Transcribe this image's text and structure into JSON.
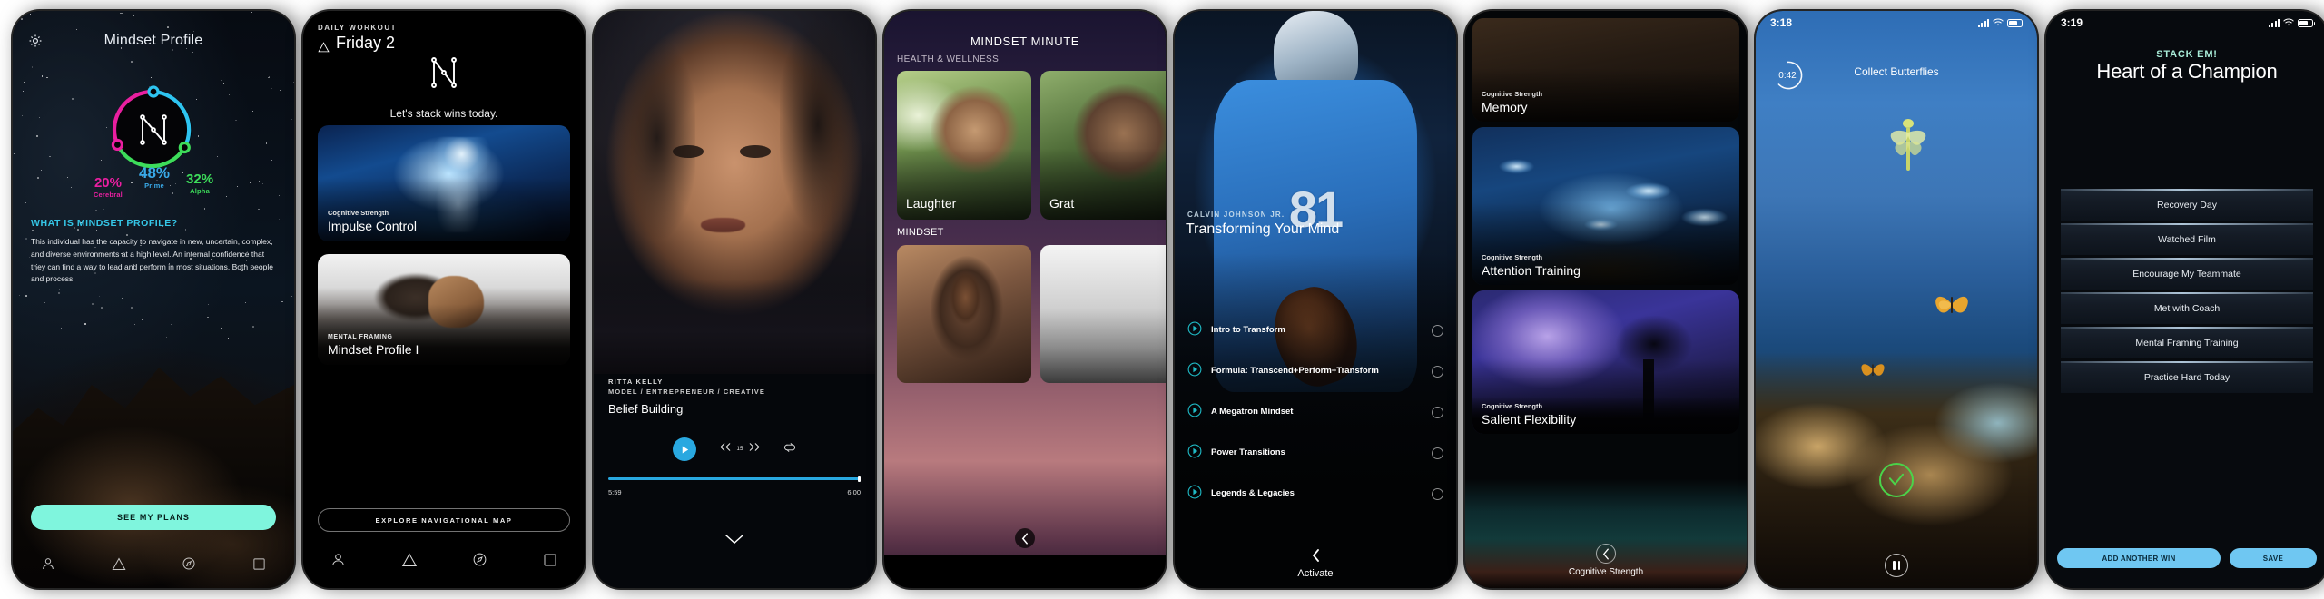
{
  "screens": {
    "profile": {
      "title": "Mindset Profile",
      "gear_icon": "gear-icon",
      "logo": "neuro-n-logo",
      "metrics": [
        {
          "value": "20%",
          "label": "Cerebral",
          "color": "#e91fa0"
        },
        {
          "value": "48%",
          "label": "Prime",
          "color": "#39a9e8"
        },
        {
          "value": "32%",
          "label": "Alpha",
          "color": "#3ddc5a"
        }
      ],
      "section_heading": "WHAT IS MINDSET PROFILE?",
      "body": "This individual has the capacity to navigate in new, uncertain, complex, and diverse environments at a high level. An internal confidence that they can find a way to lead and perform in most situations. Both people and process",
      "cta": "SEE MY PLANS",
      "tabs": [
        "profile-icon",
        "triangle-icon",
        "compass-icon",
        "square-icon"
      ]
    },
    "workout": {
      "kicker": "DAILY WORKOUT",
      "day": "Friday 2",
      "day_icon": "triangle-icon",
      "tagline": "Let's stack wins today.",
      "cards": [
        {
          "category": "Cognitive Strength",
          "title": "Impulse Control"
        },
        {
          "category": "MENTAL FRAMING",
          "title": "Mindset Profile I"
        }
      ],
      "explore_button": "EXPLORE NAVIGATIONAL MAP",
      "tabs": [
        "profile-icon",
        "triangle-icon",
        "compass-icon",
        "square-icon"
      ]
    },
    "player": {
      "name": "RITTA KELLY",
      "role": "MODEL / ENTREPRENEUR / CREATIVE",
      "track_title": "Belief Building",
      "play_icon": "play-icon",
      "rewind_icon": "rewind-15-icon",
      "forward_icon": "forward-15-icon",
      "skip_seconds": "15",
      "repeat_icon": "repeat-icon",
      "elapsed": "5:59",
      "duration": "6:00",
      "collapse_icon": "chevron-down-icon"
    },
    "minute": {
      "title": "MINDSET MINUTE",
      "section1": "HEALTH & WELLNESS",
      "row1": [
        "Laughter",
        "Grat"
      ],
      "section2": "MINDSET",
      "back_icon": "chevron-left-icon"
    },
    "transform": {
      "name": "CALVIN JOHNSON JR.",
      "title": "Transforming Your Mind",
      "jersey_number": "81",
      "lessons": [
        "Intro to Transform",
        "Formula: Transcend+Perform+Transform",
        "A Megatron Mindset",
        "Power Transitions",
        "Legends & Legacies"
      ],
      "footer_label": "Activate",
      "footer_icon": "chevron-left-icon"
    },
    "cognitive": {
      "cards": [
        {
          "category": "Cognitive Strength",
          "title": "Memory"
        },
        {
          "category": "Cognitive Strength",
          "title": "Attention Training"
        },
        {
          "category": "Cognitive Strength",
          "title": "Salient Flexibility"
        }
      ],
      "footer_label": "Cognitive Strength",
      "footer_icon": "chevron-left-icon"
    },
    "butterflies": {
      "status_time": "3:18",
      "timer": "0:42",
      "task": "Collect Butterflies",
      "check_icon": "check-icon",
      "pause_icon": "pause-icon"
    },
    "stack": {
      "status_time": "3:19",
      "kicker": "STACK EM!",
      "title": "Heart of a Champion",
      "wins": [
        "Recovery Day",
        "Watched Film",
        "Encourage My Teammate",
        "Met with Coach",
        "Mental Framing Training",
        "Practice Hard Today"
      ],
      "add_button": "ADD ANOTHER WIN",
      "save_button": "SAVE"
    }
  },
  "colors": {
    "accent_mint": "#7ff5dd",
    "accent_blue": "#29a8e0",
    "accent_teal": "#35c7e8",
    "cerebral": "#e91fa0",
    "prime": "#39a9e8",
    "alpha": "#3ddc5a",
    "stack_button": "#6fc7f2",
    "stack_kicker": "#a8ecd8"
  }
}
